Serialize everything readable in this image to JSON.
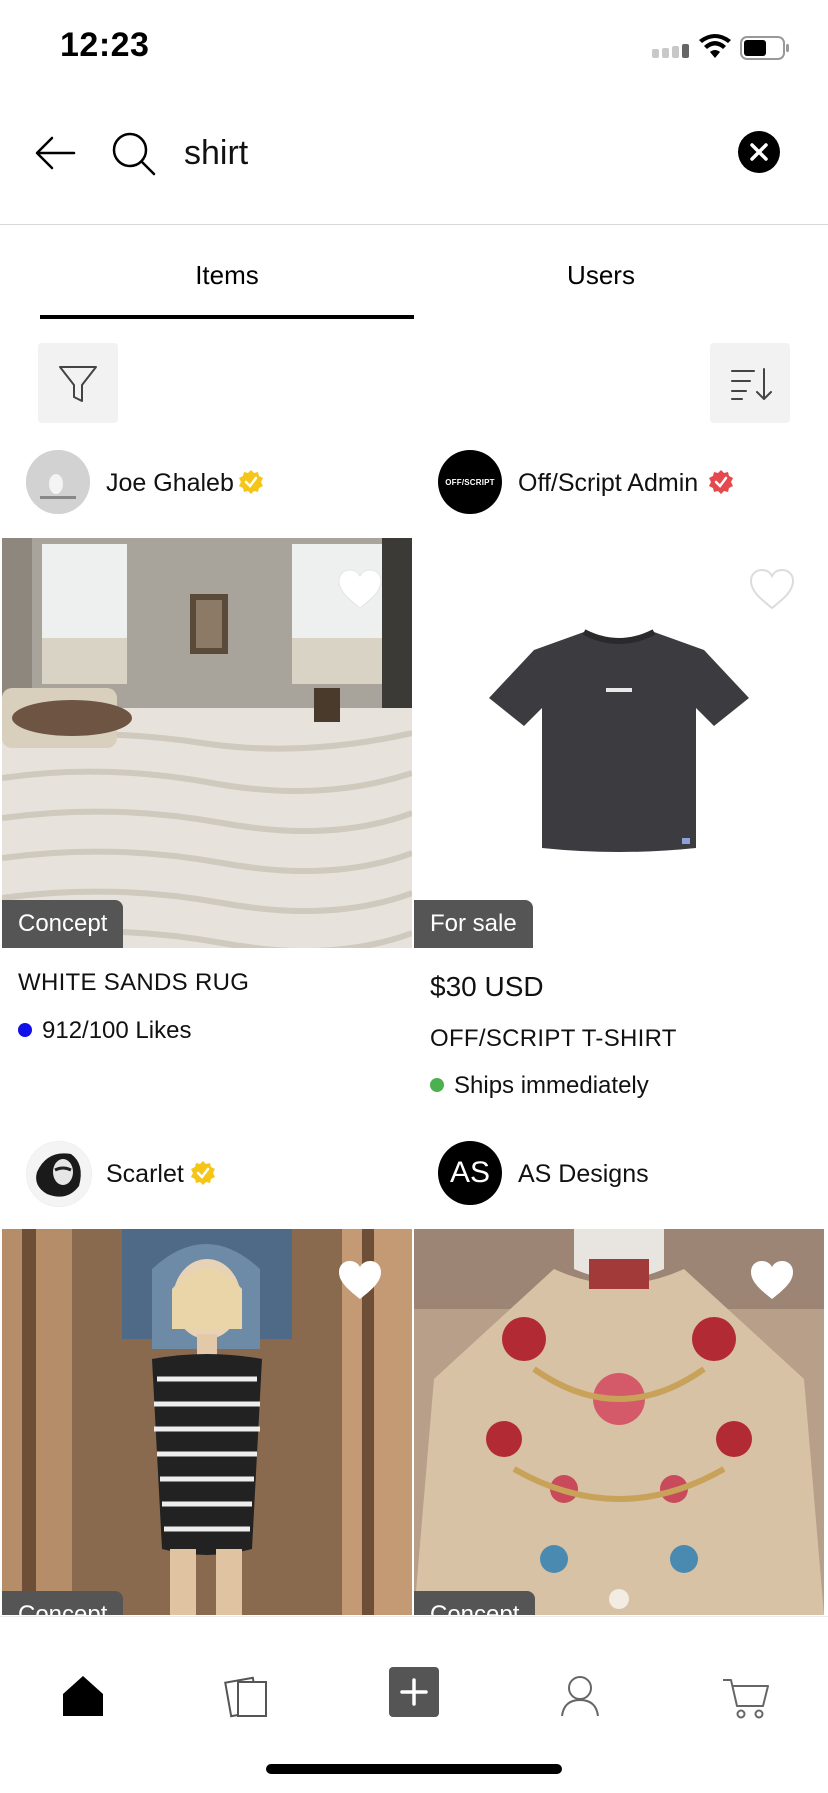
{
  "status_bar": {
    "time": "12:23"
  },
  "search": {
    "query": "shirt",
    "placeholder": "Search"
  },
  "tabs": [
    {
      "label": "Items",
      "active": true
    },
    {
      "label": "Users",
      "active": false
    }
  ],
  "listings": [
    {
      "user": "Joe Ghaleb",
      "badge_color": "#f5c518",
      "tag": "Concept",
      "title": "WHITE SANDS RUG",
      "status_dot_color": "#1010e8",
      "status_text": "912/100 Likes",
      "liked": true
    },
    {
      "user": "Off/Script Admin",
      "avatar_text": "OFF/SCRIPT",
      "badge_color": "#e5484d",
      "tag": "For sale",
      "price": "$30 USD",
      "title": "OFF/SCRIPT T-SHIRT",
      "status_dot_color": "#4caf50",
      "status_text": "Ships immediately",
      "liked": false
    },
    {
      "user": "Scarlet",
      "badge_color": "#f5c518",
      "tag": "Concept",
      "liked": true
    },
    {
      "user": "AS Designs",
      "avatar_text": "AS",
      "tag": "Concept",
      "liked": true
    }
  ],
  "bottom_nav": [
    "home-icon",
    "feed-icon",
    "add-icon",
    "profile-icon",
    "cart-icon"
  ],
  "colors": {
    "accent": "#000000",
    "tag_bg": "#555555",
    "concept_badge": "#f5c518",
    "verified_red": "#e5484d"
  }
}
